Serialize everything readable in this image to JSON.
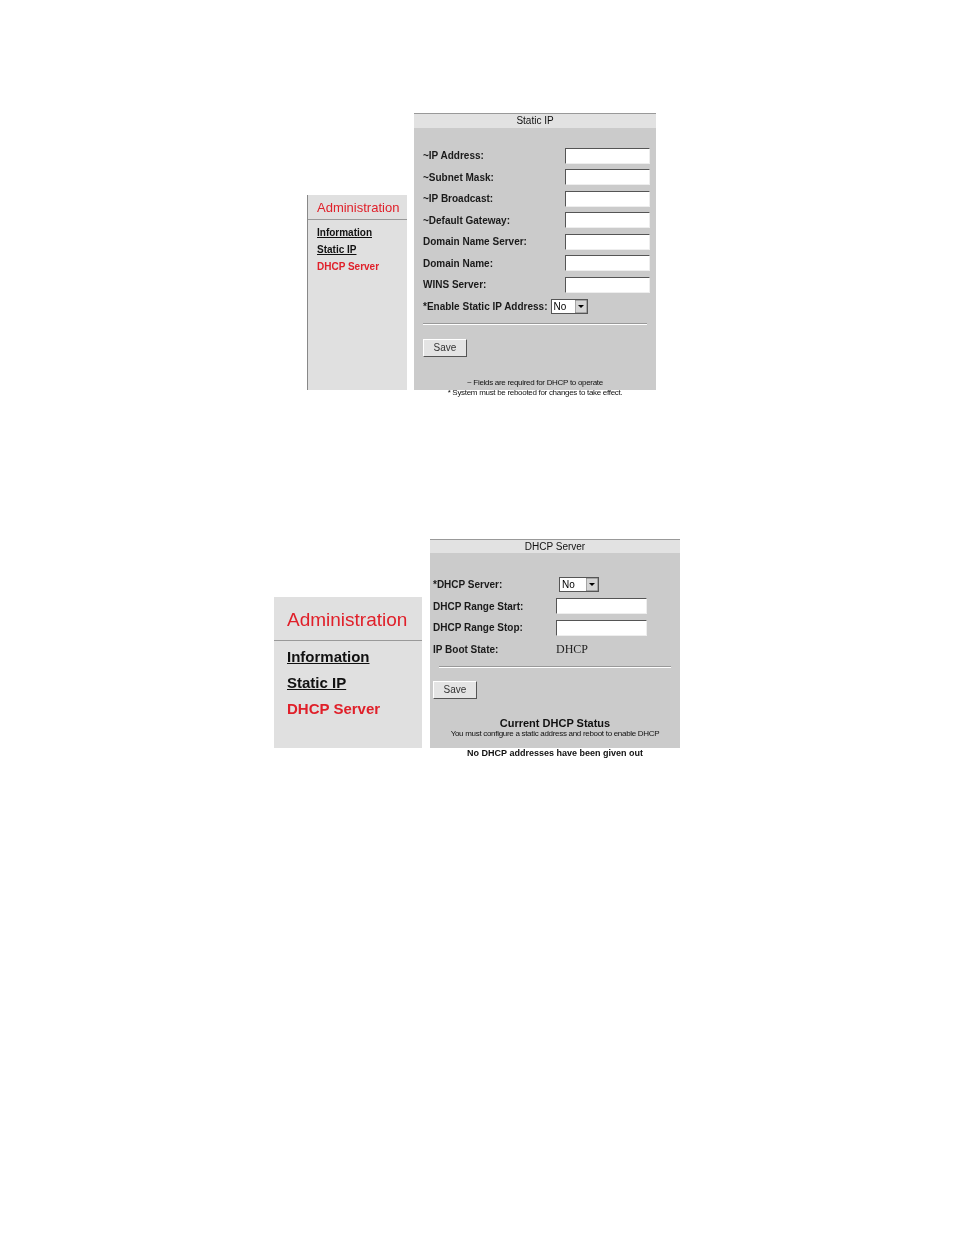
{
  "figures": [
    {
      "sidebar": {
        "title": "Administration",
        "items": [
          {
            "label": "Information",
            "selected": false
          },
          {
            "label": "Static IP",
            "selected": false
          },
          {
            "label": "DHCP Server",
            "selected": true
          }
        ]
      },
      "panel": {
        "title": "Static IP",
        "fields": [
          {
            "kind": "text",
            "label": "~IP Address:"
          },
          {
            "kind": "text",
            "label": "~Subnet Mask:"
          },
          {
            "kind": "text",
            "label": "~IP Broadcast:"
          },
          {
            "kind": "text",
            "label": "~Default Gateway:"
          },
          {
            "kind": "text",
            "label": "Domain Name Server:"
          },
          {
            "kind": "text",
            "label": "Domain Name:"
          },
          {
            "kind": "text",
            "label": "WINS Server:"
          },
          {
            "kind": "select",
            "label": "*Enable Static IP Address:",
            "value": "No"
          }
        ],
        "button": "Save",
        "notes": [
          {
            "kind": "small",
            "text": "~ Fields are required for DHCP to operate"
          },
          {
            "kind": "small",
            "text": "* System must be rebooted for changes to take effect."
          }
        ]
      }
    },
    {
      "sidebar": {
        "title": "Administration",
        "items": [
          {
            "label": "Information",
            "selected": false
          },
          {
            "label": "Static IP",
            "selected": false
          },
          {
            "label": "DHCP Server",
            "selected": true
          }
        ]
      },
      "panel": {
        "title": "DHCP Server",
        "fields": [
          {
            "kind": "select",
            "label": "*DHCP Server:",
            "value": "No"
          },
          {
            "kind": "text",
            "label": "DHCP Range Start:"
          },
          {
            "kind": "text",
            "label": "DHCP Range Stop:"
          },
          {
            "kind": "value",
            "label": "IP Boot State:",
            "value": "DHCP"
          }
        ],
        "button": "Save",
        "notes": [
          {
            "kind": "heading",
            "text": "Current DHCP Status"
          },
          {
            "kind": "small",
            "text": "You must configure a static address and reboot to enable DHCP"
          },
          {
            "kind": "bold",
            "text": "No DHCP addresses have been given out"
          }
        ]
      }
    }
  ]
}
